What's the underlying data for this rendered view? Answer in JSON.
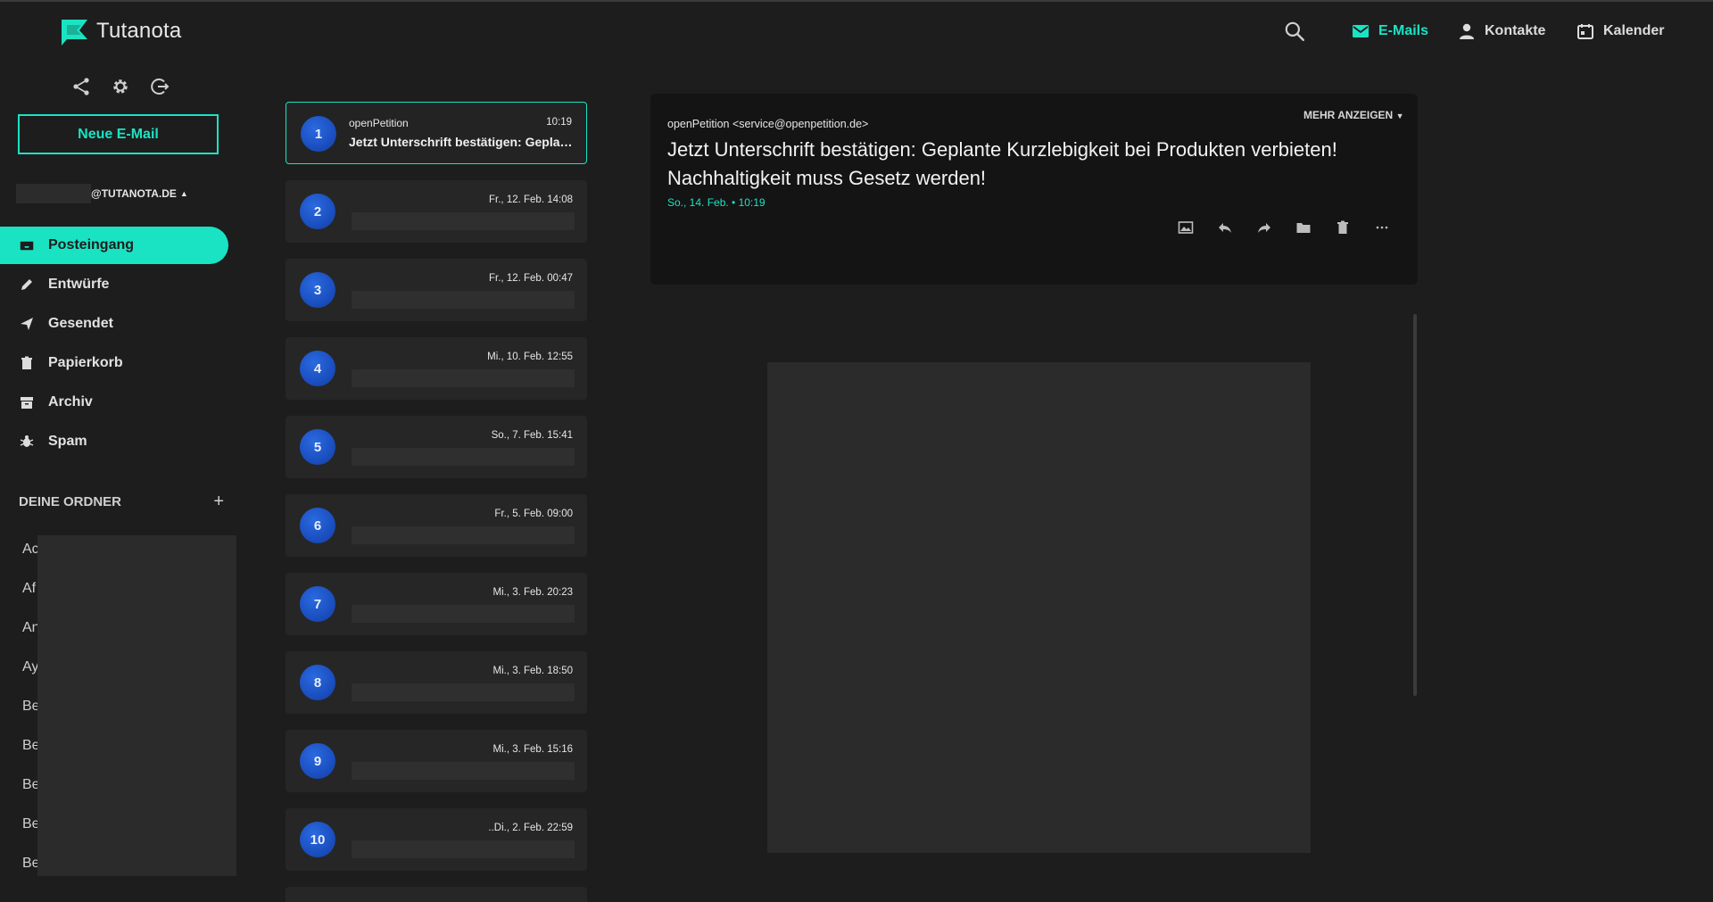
{
  "app": {
    "name": "Tutanota"
  },
  "header": {
    "nav": [
      {
        "label": "E-Mails",
        "icon": "mail-icon",
        "active": true
      },
      {
        "label": "Kontakte",
        "icon": "person-icon",
        "active": false
      },
      {
        "label": "Kalender",
        "icon": "calendar-icon",
        "active": false
      }
    ]
  },
  "sidebar": {
    "new_mail_label": "Neue E-Mail",
    "account_domain": "@TUTANOTA.DE",
    "folders": [
      {
        "label": "Posteingang",
        "icon": "inbox-icon",
        "active": true
      },
      {
        "label": "Entwürfe",
        "icon": "pencil-icon",
        "active": false
      },
      {
        "label": "Gesendet",
        "icon": "send-icon",
        "active": false
      },
      {
        "label": "Papierkorb",
        "icon": "trash-icon",
        "active": false
      },
      {
        "label": "Archiv",
        "icon": "archive-icon",
        "active": false
      },
      {
        "label": "Spam",
        "icon": "bug-icon",
        "active": false
      }
    ],
    "your_folders_label": "DEINE ORDNER",
    "add_label": "+",
    "custom_folders": [
      "Ac",
      "Af",
      "An",
      "Ay",
      "Be",
      "Be",
      "Be",
      "Be",
      "Be"
    ]
  },
  "mail_list": [
    {
      "num": "1",
      "sender": "openPetition",
      "time": "10:19",
      "subject": "Jetzt Unterschrift bestätigen: Geplante Kurzlebigkeit bei Produkten verbieten!",
      "selected": true
    },
    {
      "num": "2",
      "time": "Fr., 12. Feb. 14:08"
    },
    {
      "num": "3",
      "time": "Fr., 12. Feb. 00:47"
    },
    {
      "num": "4",
      "time": "Mi., 10. Feb. 12:55"
    },
    {
      "num": "5",
      "time": "So., 7. Feb. 15:41"
    },
    {
      "num": "6",
      "time": "Fr., 5. Feb. 09:00"
    },
    {
      "num": "7",
      "time": "Mi., 3. Feb. 20:23"
    },
    {
      "num": "8",
      "time": "Mi., 3. Feb. 18:50"
    },
    {
      "num": "9",
      "time": "Mi., 3. Feb. 15:16"
    },
    {
      "num": "10",
      "time": "..Di., 2. Feb. 22:59"
    }
  ],
  "viewer": {
    "from": "openPetition <service@openpetition.de>",
    "more_label": "MEHR ANZEIGEN",
    "subject": "Jetzt Unterschrift bestätigen: Geplante Kurzlebigkeit bei Produkten verbieten! Nachhaltigkeit muss Gesetz werden!",
    "date": "So., 14. Feb. • 10:19",
    "actions": [
      "image-icon",
      "reply-icon",
      "forward-icon",
      "folder-icon",
      "trash-icon",
      "more-icon"
    ]
  },
  "colors": {
    "accent": "#1ae3c3",
    "background": "#1d1d1d",
    "avatar": "#1b4fc0"
  }
}
